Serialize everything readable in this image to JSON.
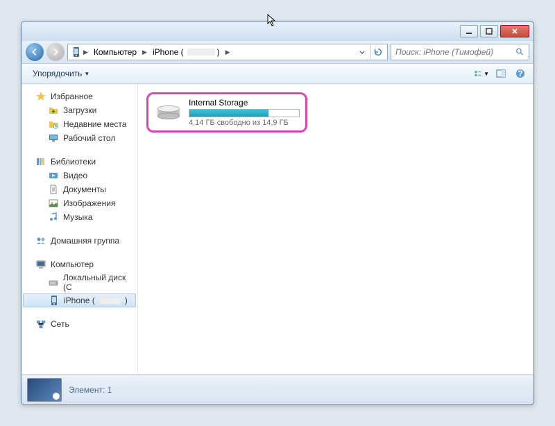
{
  "titlebar": {},
  "nav": {
    "breadcrumbs": [
      {
        "label": "Компьютер"
      },
      {
        "label": "iPhone ("
      }
    ],
    "search_placeholder": "Поиск: iPhone (Тимофей)"
  },
  "cmdbar": {
    "organize": "Упорядочить"
  },
  "sidebar": {
    "favorites": {
      "label": "Избранное",
      "items": [
        {
          "label": "Загрузки"
        },
        {
          "label": "Недавние места"
        },
        {
          "label": "Рабочий стол"
        }
      ]
    },
    "libraries": {
      "label": "Библиотеки",
      "items": [
        {
          "label": "Видео"
        },
        {
          "label": "Документы"
        },
        {
          "label": "Изображения"
        },
        {
          "label": "Музыка"
        }
      ]
    },
    "homegroup": {
      "label": "Домашняя группа"
    },
    "computer": {
      "label": "Компьютер",
      "items": [
        {
          "label": "Локальный диск (C"
        },
        {
          "label": "iPhone ("
        }
      ]
    },
    "network": {
      "label": "Сеть"
    }
  },
  "content": {
    "drive": {
      "name": "Internal Storage",
      "subtext": "4,14 ГБ свободно из 14,9 ГБ",
      "fill_percent": 72
    }
  },
  "status": {
    "elements_label": "Элемент: 1"
  }
}
